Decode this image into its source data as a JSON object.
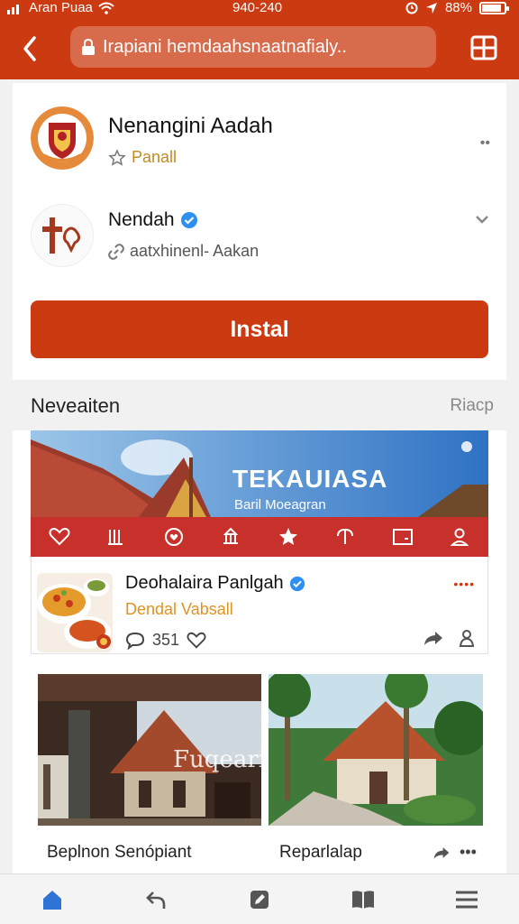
{
  "status": {
    "carrier": "Aran Puaa",
    "time": "940-240",
    "battery": "88%",
    "battery_level": 0.88
  },
  "browser": {
    "url": "Irapiani hemdaahsnaatnafialy.."
  },
  "accounts": [
    {
      "name": "Nenangini Aadah",
      "subtitle": "Panall",
      "more": "••"
    },
    {
      "name": "Nendah",
      "subtitle": "aatxhinenl- Aakan",
      "verified": true
    }
  ],
  "install_label": "Instal",
  "section": {
    "title": "Neveaiten",
    "link": "Riacp"
  },
  "banner": {
    "title": "TEKAUIASA",
    "subtitle": "Baril Moeagran"
  },
  "post": {
    "title": "Deohalaira Panlgah",
    "subtitle": "Dendal Vabsall",
    "more": "••••",
    "comments": "351"
  },
  "tiles": {
    "left_overlay": "Fuqeari",
    "left_caption": "Beplnon Senópiant",
    "right_caption": "Reparlalap",
    "right_more": "•••"
  },
  "colors": {
    "brand": "#cc3a12",
    "banner_strip": "#c8302b",
    "verified": "#2f8ff0",
    "accent_text": "#e0931e"
  }
}
